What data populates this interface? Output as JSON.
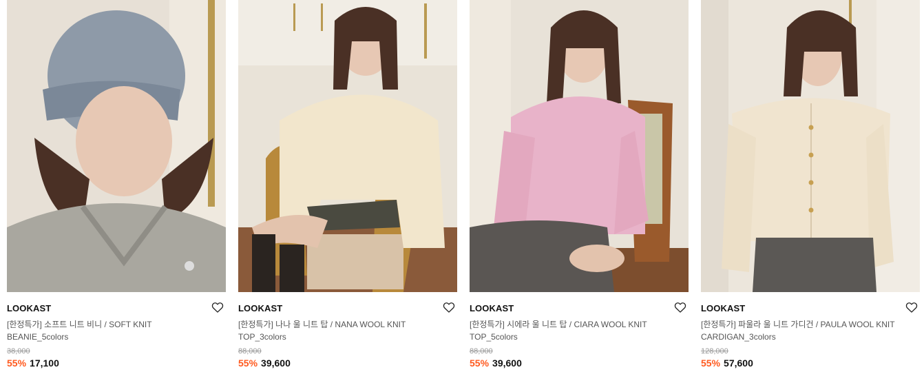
{
  "colors": {
    "discount": "#ff5a1f",
    "text": "#111111",
    "subtext": "#555555",
    "strike": "#999999"
  },
  "products": [
    {
      "brand": "LOOKAST",
      "name": "[한정특가] 소프트 니트 비니 / SOFT KNIT BEANIE_5colors",
      "original_price": "38,000",
      "discount": "55%",
      "price": "17,100",
      "wish_icon": "heart-outline-icon",
      "image": "model-gray-beanie-sweater"
    },
    {
      "brand": "LOOKAST",
      "name": "[한정특가] 나나 울 니트 탑 / NANA WOOL KNIT TOP_3colors",
      "original_price": "88,000",
      "discount": "55%",
      "price": "39,600",
      "wish_icon": "heart-outline-icon",
      "image": "model-cream-knit-chair"
    },
    {
      "brand": "LOOKAST",
      "name": "[한정특가] 시에라 울 니트 탑 / CIARA WOOL KNIT TOP_5colors",
      "original_price": "88,000",
      "discount": "55%",
      "price": "39,600",
      "wish_icon": "heart-outline-icon",
      "image": "model-pink-knit-chair"
    },
    {
      "brand": "LOOKAST",
      "name": "[한정특가] 파울라 울 니트 가디건 / PAULA WOOL KNIT CARDIGAN_3colors",
      "original_price": "128,000",
      "discount": "55%",
      "price": "57,600",
      "wish_icon": "heart-outline-icon",
      "image": "model-ivory-cardigan"
    }
  ]
}
